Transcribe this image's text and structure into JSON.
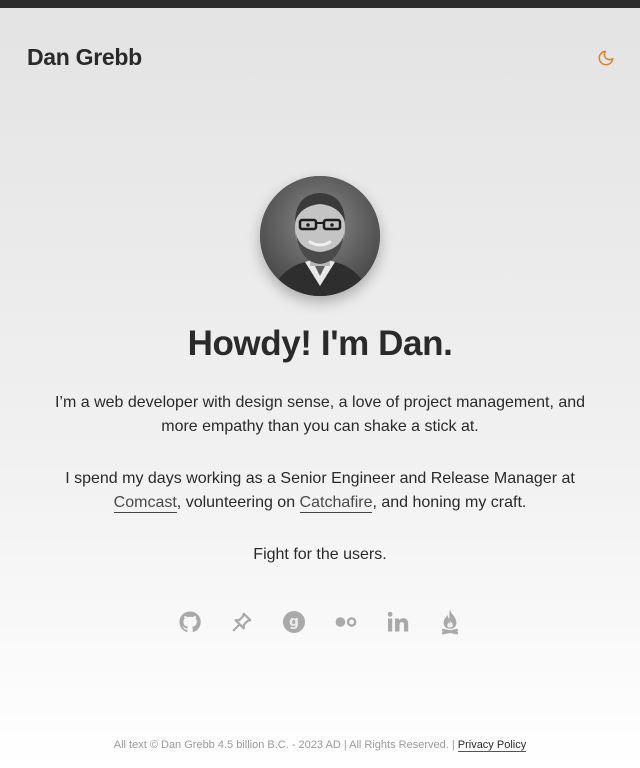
{
  "header": {
    "site_title": "Dan Grebb",
    "theme_toggle_icon": "moon-icon",
    "accent_color": "#d9822b"
  },
  "hero": {
    "avatar_icon": "profile-photo",
    "headline": "Howdy! I'm Dan.",
    "intro": "I’m a web developer with design sense, a love of project management, and more empathy than you can shake a stick at.",
    "work_prefix": "I spend my days working as a Senior Engineer and Release Manager at ",
    "work_link_comcast": "Comcast",
    "work_middle": ", volunteering on ",
    "work_link_catchafire": "Catchafire",
    "work_suffix": ", and honing my craft.",
    "motto": "Fight for the users."
  },
  "socials": [
    {
      "icon": "github-icon"
    },
    {
      "icon": "pinboard-icon"
    },
    {
      "icon": "goodreads-icon"
    },
    {
      "icon": "flickr-icon"
    },
    {
      "icon": "linkedin-icon"
    },
    {
      "icon": "campfire-icon"
    }
  ],
  "footer": {
    "copyright": "All text © Dan Grebb 4.5 billion B.C. - 2023 AD | All Rights Reserved. | ",
    "privacy_link": "Privacy Policy"
  }
}
